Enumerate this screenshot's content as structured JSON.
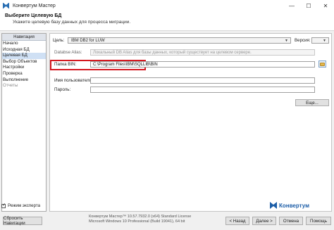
{
  "window": {
    "title": "Конвертум Мастер",
    "controls": [
      "—",
      "☐",
      "✕"
    ]
  },
  "header": {
    "title": "Выберите Целевую БД",
    "subtitle": "Укажите целевую базу данных для процесса миграции."
  },
  "navigation": {
    "header": "Навигация",
    "items": [
      {
        "label": "Начало",
        "state": "normal"
      },
      {
        "label": "Исходная БД",
        "state": "normal"
      },
      {
        "label": "Целевая БД",
        "state": "active"
      },
      {
        "label": "Выбор Объектов",
        "state": "normal"
      },
      {
        "label": "Настройки",
        "state": "normal"
      },
      {
        "label": "Проверка",
        "state": "normal"
      },
      {
        "label": "Выполнение",
        "state": "normal"
      },
      {
        "label": "Отчеты",
        "state": "disabled"
      }
    ],
    "expert_mode": {
      "label": "Режим эксперта",
      "checked": true
    }
  },
  "form": {
    "target_label": "Цель:",
    "target_value": "IBM DB2 for LUW",
    "version_label": "Версия:",
    "version_value": "",
    "alias_label": "Databse Alias:",
    "alias_placeholder": "Локальный DB Alias для базы данных, который существует на целевом сервере.",
    "bin_label": "Папка BIN:",
    "bin_value": "C:\\Program Files\\IBM\\SQLLIB\\BIN",
    "user_label": "Имя пользователя:",
    "user_value": "",
    "password_label": "Пароль:",
    "password_value": "",
    "more_button": "Еще..."
  },
  "footer": {
    "reset_nav": "Сбросить Навигации",
    "version_lines": [
      "Конвертум Мастер™ 10.57.7932.0 (x64) Standard License",
      "Microsoft Windows 10 Professional (Build 19041), 64 bit"
    ],
    "brand": "Конвертум",
    "back": "< Назад",
    "next": "Далее >",
    "cancel": "Отмена",
    "help": "Помощь"
  },
  "colors": {
    "accent": "#1d5ea8",
    "highlight_border": "#d4181f",
    "active_nav": "#cfe0f4"
  }
}
